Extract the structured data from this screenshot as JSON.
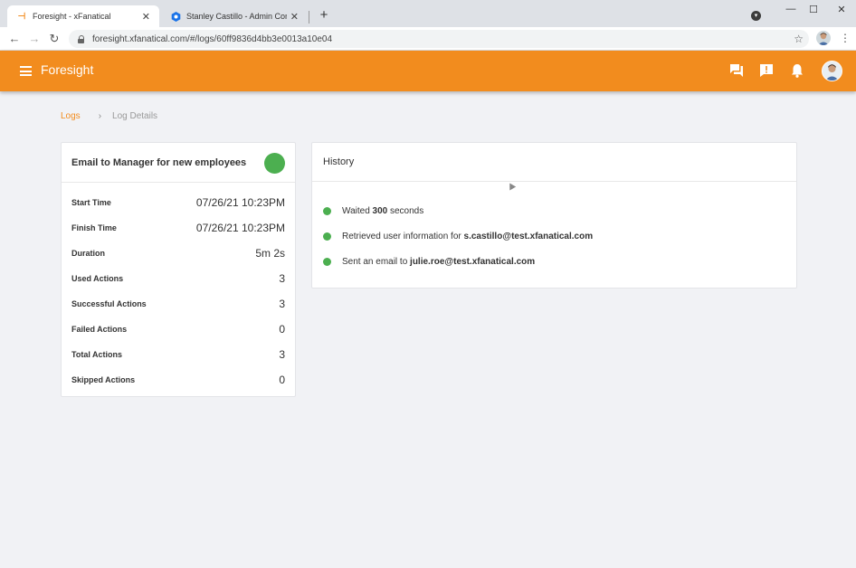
{
  "browser": {
    "tabs": [
      {
        "title": "Foresight - xFanatical",
        "active": true
      },
      {
        "title": "Stanley Castillo - Admin Console",
        "active": false
      }
    ],
    "new_tab": "+",
    "address": "foresight.xfanatical.com/#/logs/60ff9836d4bb3e0013a10e04",
    "window_controls": {
      "minimize": "—",
      "maximize": "☐",
      "close": "✕"
    }
  },
  "appbar": {
    "title": "Foresight",
    "brand_color": "#f28c1e",
    "icons": [
      "chat-icon",
      "feedback-icon",
      "notifications-icon",
      "user-avatar"
    ]
  },
  "breadcrumb": {
    "link": "Logs",
    "separator": "›",
    "current": "Log Details"
  },
  "log": {
    "title": "Email to Manager for new employees",
    "status_color": "#4caf50",
    "rows": [
      {
        "label": "Start Time",
        "value": "07/26/21 10:23PM"
      },
      {
        "label": "Finish Time",
        "value": "07/26/21 10:23PM"
      },
      {
        "label": "Duration",
        "value": "5m 2s"
      },
      {
        "label": "Used Actions",
        "value": "3"
      },
      {
        "label": "Successful Actions",
        "value": "3"
      },
      {
        "label": "Failed Actions",
        "value": "0"
      },
      {
        "label": "Total Actions",
        "value": "3"
      },
      {
        "label": "Skipped Actions",
        "value": "0"
      }
    ]
  },
  "history": {
    "title": "History",
    "items": [
      {
        "prefix": "Waited ",
        "bold": "300",
        "suffix": " seconds"
      },
      {
        "prefix": "Retrieved user information for ",
        "bold": "s.castillo@test.xfanatical.com",
        "suffix": ""
      },
      {
        "prefix": "Sent an email to ",
        "bold": "julie.roe@test.xfanatical.com",
        "suffix": ""
      }
    ]
  }
}
